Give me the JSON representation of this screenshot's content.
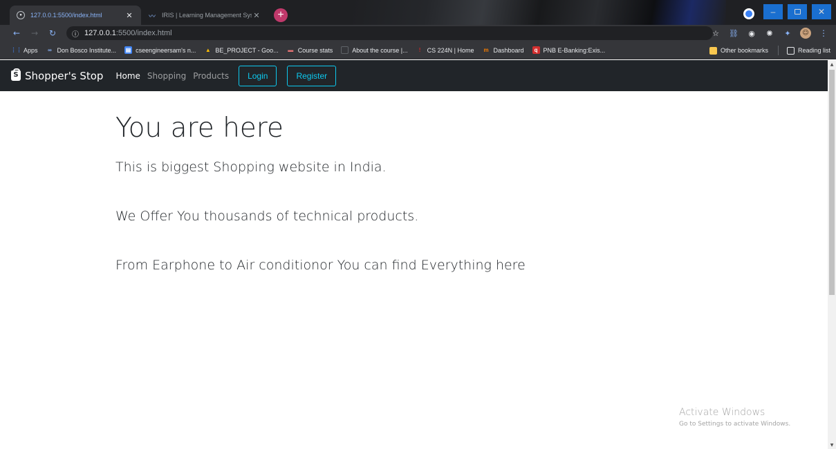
{
  "browser": {
    "tabs": [
      {
        "title": "127.0.0.1:5500/index.html",
        "close": "✕"
      },
      {
        "title": "IRIS | Learning Management Syst",
        "close": "✕"
      }
    ],
    "new_tab": "+",
    "window_controls": {
      "minimize": "–",
      "close": "✕"
    },
    "address": {
      "info_glyph": "ⓘ",
      "host": "127.0.0.1",
      "rest": ":5500/index.html"
    },
    "bookmarks": [
      {
        "label": "Apps",
        "icon": "apps-grid-icon",
        "glyph": "⋮⋮",
        "color": "#4285f4"
      },
      {
        "label": "Don Bosco Institute...",
        "icon": "infinity-icon",
        "glyph": "∞",
        "color": "#8ab4f8"
      },
      {
        "label": "cseengineersam's n...",
        "icon": "notebook-icon",
        "glyph": "▤",
        "color": "#4285f4"
      },
      {
        "label": "BE_PROJECT - Goo...",
        "icon": "google-drive-icon",
        "glyph": "▲",
        "color": "#fbbc04"
      },
      {
        "label": "Course stats",
        "icon": "chart-icon",
        "glyph": "▬",
        "color": "#e57373"
      },
      {
        "label": "About the course |...",
        "icon": "page-icon",
        "glyph": "",
        "color": "#5f6368"
      },
      {
        "label": "CS 224N | Home",
        "icon": "stanford-icon",
        "glyph": "!",
        "color": "#c62828"
      },
      {
        "label": "Dashboard",
        "icon": "dashboard-icon",
        "glyph": "m",
        "color": "#f57c00"
      },
      {
        "label": "PNB E-Banking:Exis...",
        "icon": "bank-icon",
        "glyph": "q",
        "color": "#d32f2f"
      }
    ],
    "bookmarks_right": {
      "other": "Other bookmarks",
      "reading": "Reading list"
    }
  },
  "site": {
    "brand": "Shopper's Stop",
    "nav": [
      "Home",
      "Shopping",
      "Products"
    ],
    "login_label": "Login",
    "register_label": "Register"
  },
  "main": {
    "heading": "You are here",
    "lines": [
      "This is biggest Shopping website in India.",
      "We Offer You thousands of technical products.",
      "From Earphone to Air conditionor You can find Everything here"
    ]
  },
  "watermark": {
    "title": "Activate Windows",
    "subtitle": "Go to Settings to activate Windows."
  }
}
